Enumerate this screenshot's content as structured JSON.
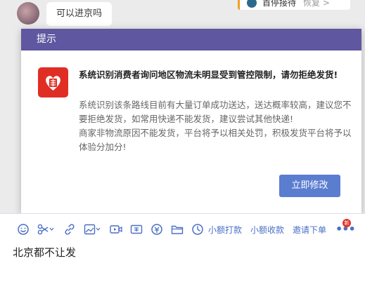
{
  "chat": {
    "customer_message": "可以进京吗",
    "top_card": {
      "label": "首停接待",
      "action": "恢复 >"
    }
  },
  "modal": {
    "header_title": "提示",
    "title": "系统识别消费者询问地区物流未明显受到管控限制，请勿拒绝发货!",
    "body_lines": [
      "系统识别该条路线目前有大量订单成功送达，送达概率较高，建议您不要拒绝发货，如常用快递不能发货，建议尝试其他快递!",
      "商家非物流原因不能发货，平台将予以相关处罚，积极发货平台将予以体验分加分!"
    ],
    "button_label": "立即修改",
    "colors": {
      "header": "#5f57a0",
      "button": "#5b7dd0",
      "logo": "#e02e24"
    }
  },
  "toolbar": {
    "icons": [
      "emoji-icon",
      "scissors-icon",
      "link-icon",
      "image-icon",
      "video-icon",
      "voucher-icon",
      "price-icon",
      "folder-icon",
      "clock-icon"
    ],
    "links": [
      "小额打款",
      "小额收款",
      "邀请下单"
    ],
    "more_label": "•••",
    "new_badge": "新"
  },
  "editor": {
    "text": "北京都不让发"
  }
}
